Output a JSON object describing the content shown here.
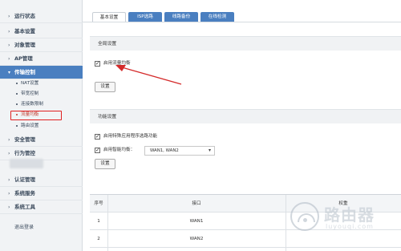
{
  "sidebar": {
    "items": [
      {
        "label": "运行状态"
      },
      {
        "label": "基本设置"
      },
      {
        "label": "对象管理"
      },
      {
        "label": "AP管理"
      },
      {
        "label": "传输控制"
      },
      {
        "label": "安全管理"
      },
      {
        "label": "行为管控"
      },
      {
        "label": "认证管理"
      },
      {
        "label": "系统服务"
      },
      {
        "label": "系统工具"
      }
    ],
    "subitems": [
      {
        "label": "NAT设置"
      },
      {
        "label": "带宽控制"
      },
      {
        "label": "连接数限制"
      },
      {
        "label": "流量均衡"
      },
      {
        "label": "路由设置"
      }
    ],
    "logout": "退出登录"
  },
  "tabs": [
    {
      "label": "基本设置"
    },
    {
      "label": "ISP选路"
    },
    {
      "label": "线路备份"
    },
    {
      "label": "在线检测"
    }
  ],
  "global": {
    "title": "全局设置",
    "enable_label": "启用流量均衡",
    "enable_checked": true,
    "save_label": "设置"
  },
  "func": {
    "title": "功能设置",
    "special_label": "启用特殊应用程序选路功能",
    "special_checked": true,
    "smart_label": "启用智能均衡：",
    "smart_checked": true,
    "smart_value": "WAN1, WAN2",
    "save_label": "设置"
  },
  "table": {
    "headers": [
      "序号",
      "接口",
      "权重"
    ],
    "rows": [
      [
        "1",
        "WAN1",
        ""
      ],
      [
        "2",
        "WAN2",
        ""
      ]
    ]
  },
  "watermark": {
    "title": "路由器",
    "sub": "luyouqi.com"
  },
  "colors": {
    "accent": "#4a7fc0",
    "highlight": "#e02020"
  }
}
